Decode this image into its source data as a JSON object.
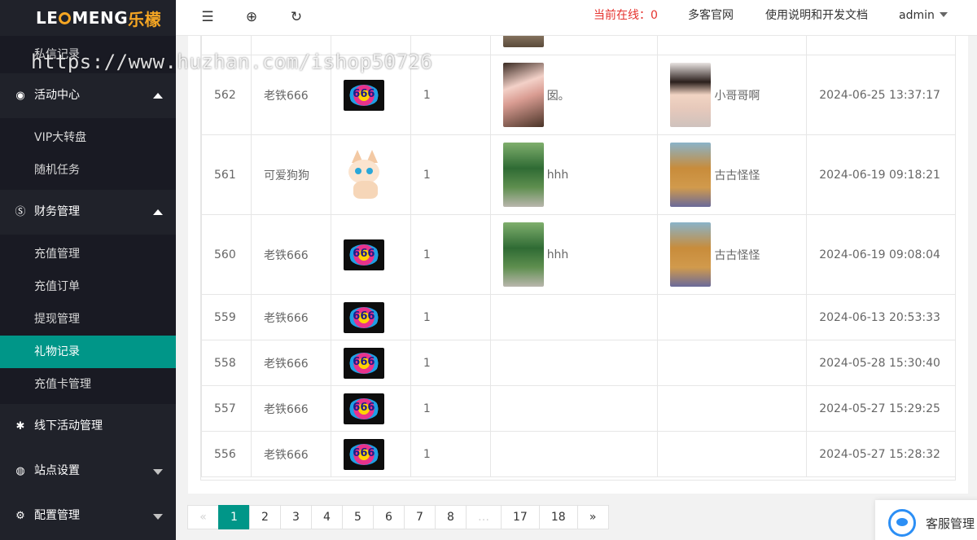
{
  "brand": {
    "logo_prefix": "LE",
    "logo_mid": "MENG",
    "logo_cn": "乐檬"
  },
  "watermark": "https://www.huzhan.com/ishop50726",
  "sidebar": {
    "top_item": "私信记录",
    "groups": [
      {
        "label": "活动中心",
        "icon": "activity-icon",
        "expanded": true,
        "items": [
          "VIP大转盘",
          "随机任务"
        ]
      },
      {
        "label": "财务管理",
        "icon": "dollar-icon",
        "expanded": true,
        "items": [
          "充值管理",
          "充值订单",
          "提现管理",
          "礼物记录",
          "充值卡管理"
        ],
        "active": "礼物记录"
      },
      {
        "label": "线下活动管理",
        "icon": "palm-icon",
        "expanded": false
      },
      {
        "label": "站点设置",
        "icon": "site-icon",
        "expanded": false
      },
      {
        "label": "配置管理",
        "icon": "gear-icon",
        "expanded": false
      }
    ]
  },
  "header": {
    "online_label": "当前在线：",
    "online_count": "0",
    "link_official": "多客官网",
    "link_docs": "使用说明和开发文档",
    "user": "admin"
  },
  "table": {
    "rows": [
      {
        "id": "562",
        "user": "老铁666",
        "gift": "666",
        "qty": "1",
        "from_img": "cake-photo",
        "from_name": "囡。",
        "to_img": "girl-photo",
        "to_name": "小哥哥啊",
        "time": "2024-06-25 13:37:17",
        "kind": "tall"
      },
      {
        "id": "561",
        "user": "可爱狗狗",
        "gift": "dog",
        "qty": "1",
        "from_img": "tree-photo",
        "from_name": "hhh",
        "to_img": "men-photo",
        "to_name": "古古怪怪",
        "time": "2024-06-19 09:18:21",
        "kind": "tall"
      },
      {
        "id": "560",
        "user": "老铁666",
        "gift": "666",
        "qty": "1",
        "from_img": "tree-photo",
        "from_name": "hhh",
        "to_img": "men-photo",
        "to_name": "古古怪怪",
        "time": "2024-06-19 09:08:04",
        "kind": "tall"
      },
      {
        "id": "559",
        "user": "老铁666",
        "gift": "666",
        "qty": "1",
        "time": "2024-06-13 20:53:33",
        "kind": "short"
      },
      {
        "id": "558",
        "user": "老铁666",
        "gift": "666",
        "qty": "1",
        "time": "2024-05-28 15:30:40",
        "kind": "short"
      },
      {
        "id": "557",
        "user": "老铁666",
        "gift": "666",
        "qty": "1",
        "time": "2024-05-27 15:29:25",
        "kind": "short"
      },
      {
        "id": "556",
        "user": "老铁666",
        "gift": "666",
        "qty": "1",
        "time": "2024-05-27 15:28:32",
        "kind": "short"
      }
    ]
  },
  "pagination": {
    "prev": "«",
    "pages": [
      "1",
      "2",
      "3",
      "4",
      "5",
      "6",
      "7",
      "8",
      "…",
      "17",
      "18"
    ],
    "current": "1",
    "next": "»"
  },
  "customer_service": "客服管理"
}
